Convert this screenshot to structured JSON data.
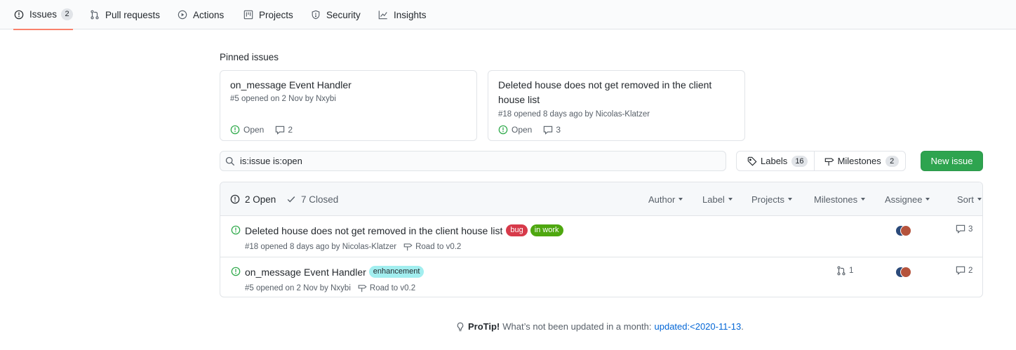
{
  "nav": {
    "tabs": [
      {
        "label": "Issues",
        "count": "2",
        "icon": "issue-opened-icon"
      },
      {
        "label": "Pull requests",
        "icon": "git-pull-request-icon"
      },
      {
        "label": "Actions",
        "icon": "play-icon"
      },
      {
        "label": "Projects",
        "icon": "project-icon"
      },
      {
        "label": "Security",
        "icon": "shield-icon"
      },
      {
        "label": "Insights",
        "icon": "graph-icon"
      }
    ]
  },
  "pinned": {
    "title": "Pinned issues",
    "cards": [
      {
        "title": "on_message Event Handler",
        "meta": "#5 opened on 2 Nov by Nxybi",
        "status": "Open",
        "comments": "2"
      },
      {
        "title": "Deleted house does not get removed in the client house list",
        "meta": "#18 opened 8 days ago by Nicolas-Klatzer",
        "status": "Open",
        "comments": "3"
      }
    ]
  },
  "search": {
    "value": "is:issue is:open"
  },
  "labels_button": {
    "label": "Labels",
    "count": "16"
  },
  "milestones_button": {
    "label": "Milestones",
    "count": "2"
  },
  "new_issue_button": {
    "label": "New issue"
  },
  "list": {
    "open_label": "2 Open",
    "closed_label": "7 Closed",
    "filters": [
      "Author",
      "Label",
      "Projects",
      "Milestones",
      "Assignee",
      "Sort"
    ],
    "issues": [
      {
        "title": "Deleted house does not get removed in the client house list",
        "labels": [
          {
            "name": "bug",
            "bg": "#d73a4a",
            "fg": "#ffffff"
          },
          {
            "name": "in work",
            "bg": "#4ea70f",
            "fg": "#ffffff"
          }
        ],
        "meta": "#18 opened 8 days ago by Nicolas-Klatzer",
        "milestone": "Road to v0.2",
        "linked_prs": "",
        "comments": "3"
      },
      {
        "title": "on_message Event Handler",
        "labels": [
          {
            "name": "enhancement",
            "bg": "#a2eeef",
            "fg": "#24292e"
          }
        ],
        "meta": "#5 opened on 2 Nov by Nxybi",
        "milestone": "Road to v0.2",
        "linked_prs": "1",
        "comments": "2"
      }
    ]
  },
  "protip": {
    "strong": "ProTip!",
    "text": "What’s not been updated in a month:",
    "link": "updated:<2020-11-13",
    "end": "."
  },
  "colors": {
    "accent": "#f9826c",
    "open_green": "#28a745",
    "button_green": "#2ea44f",
    "link": "#0366d6"
  }
}
